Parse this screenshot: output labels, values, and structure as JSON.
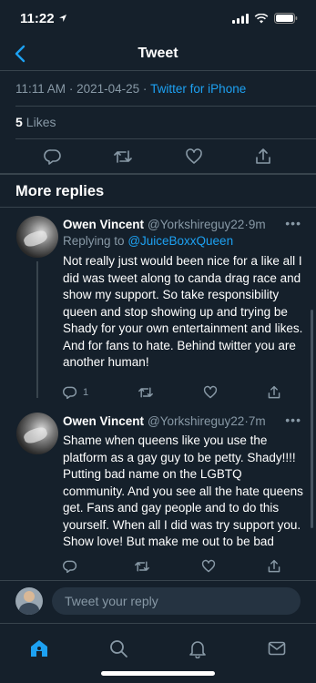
{
  "status_bar": {
    "time": "11:22"
  },
  "nav": {
    "title": "Tweet"
  },
  "tweet": {
    "time": "11:11 AM",
    "date": "2021-04-25",
    "separator": "·",
    "source": "Twitter for iPhone",
    "likes_count": "5",
    "likes_label": "Likes"
  },
  "section": {
    "title": "More replies"
  },
  "replies": [
    {
      "name": "Owen Vincent",
      "handle": "@Yorkshireguy22",
      "sep": "·",
      "time": "9m",
      "replying_prefix": "Replying to",
      "replying_to": "@JuiceBoxxQueen",
      "text": "Not really just would been nice for a like all I did was tweet along to canda drag race and show my support. So take responsibility queen and stop showing up and trying be Shady for your own entertainment and likes. And for fans to hate. Behind twitter you are another human!",
      "reply_count": "1"
    },
    {
      "name": "Owen Vincent",
      "handle": "@Yorkshireguy22",
      "sep": "·",
      "time": "7m",
      "text": "Shame when queens like you use the platform as a gay guy to be petty. Shady!!!! Putting bad name on the LGBTQ community. And you see all the hate queens get. Fans and gay people and to do this yourself. When all I did was try support you. Show love! But make me out to be bad",
      "reply_count": ""
    }
  ],
  "compose": {
    "placeholder": "Tweet your reply"
  },
  "tabs": [
    "home-icon",
    "search-icon",
    "notifications-icon",
    "messages-icon"
  ],
  "colors": {
    "background": "#15202b",
    "accent": "#1da1f2",
    "muted": "#8899a6",
    "divider": "#38444d"
  }
}
